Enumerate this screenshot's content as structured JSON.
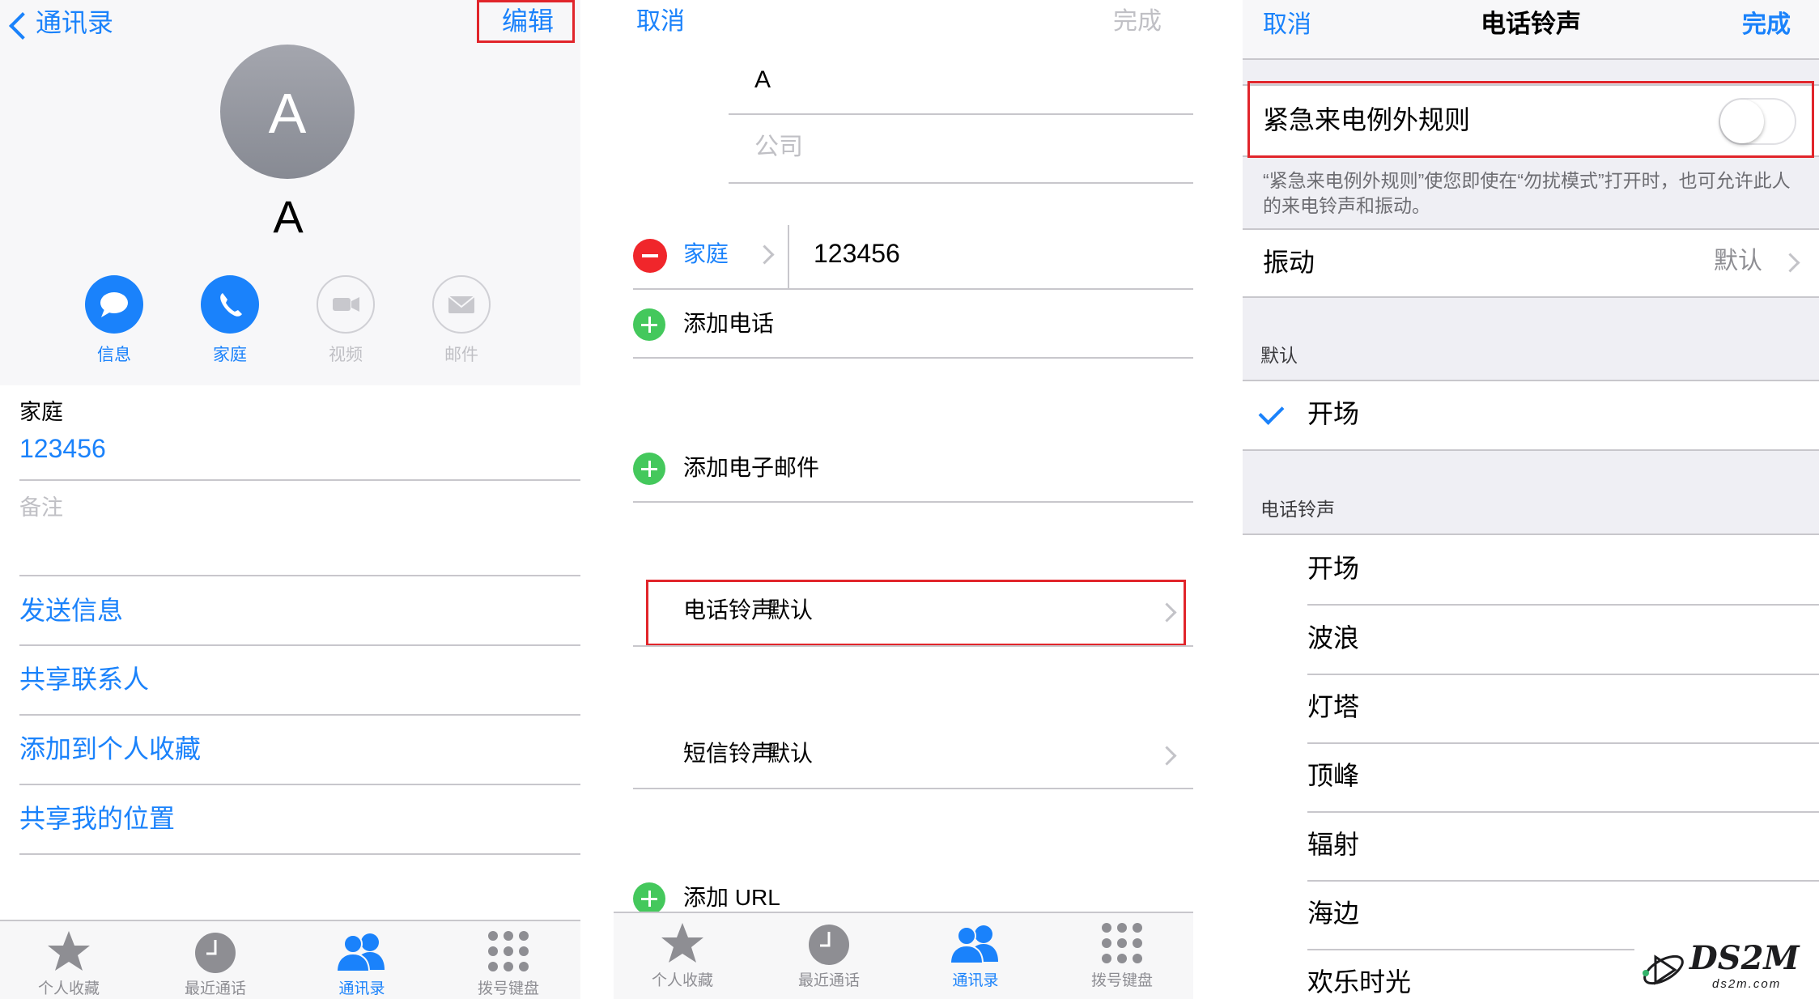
{
  "contact_view": {
    "back_label": "通讯录",
    "edit_label": "编辑",
    "avatar_initial": "A",
    "name": "A",
    "actions": [
      {
        "label": "信息",
        "icon": "message-icon",
        "enabled": true
      },
      {
        "label": "家庭",
        "icon": "phone-icon",
        "enabled": true
      },
      {
        "label": "视频",
        "icon": "video-icon",
        "enabled": false
      },
      {
        "label": "邮件",
        "icon": "mail-icon",
        "enabled": false
      }
    ],
    "phone_label": "家庭",
    "phone_number": "123456",
    "notes_placeholder": "备注",
    "links": [
      "发送信息",
      "共享联系人",
      "添加到个人收藏",
      "共享我的位置"
    ]
  },
  "edit_view": {
    "cancel_label": "取消",
    "done_label": "完成",
    "name_value": "A",
    "company_placeholder": "公司",
    "phone_type": "家庭",
    "phone_number": "123456",
    "add_phone": "添加电话",
    "add_email": "添加电子邮件",
    "ringtone_label": "电话铃声",
    "ringtone_value": "默认",
    "texttone_label": "短信铃声",
    "texttone_value": "默认",
    "add_url": "添加 URL"
  },
  "ringtone_view": {
    "cancel_label": "取消",
    "title": "电话铃声",
    "done_label": "完成",
    "emergency_bypass_label": "紧急来电例外规则",
    "emergency_bypass_on": false,
    "emergency_note": "“紧急来电例外规则”使您即使在“勿扰模式”打开时，也可允许此人的来电铃声和振动。",
    "vibration_label": "振动",
    "vibration_value": "默认",
    "default_header": "默认",
    "default_item": "开场",
    "ringtones_header": "电话铃声",
    "ringtones": [
      "开场",
      "波浪",
      "灯塔",
      "顶峰",
      "辐射",
      "海边",
      "欢乐时光"
    ]
  },
  "tabbar": {
    "items": [
      {
        "label": "个人收藏",
        "icon": "star-icon"
      },
      {
        "label": "最近通话",
        "icon": "clock-icon"
      },
      {
        "label": "通讯录",
        "icon": "contacts-icon",
        "active": true
      },
      {
        "label": "拨号键盘",
        "icon": "keypad-icon"
      }
    ]
  },
  "watermark": {
    "brand": "DS2M",
    "url": "ds2m.com"
  },
  "colors": {
    "accent": "#1a82fb",
    "highlight_box": "#e1252b",
    "add_green": "#44c85c",
    "delete_red": "#f0262b"
  }
}
